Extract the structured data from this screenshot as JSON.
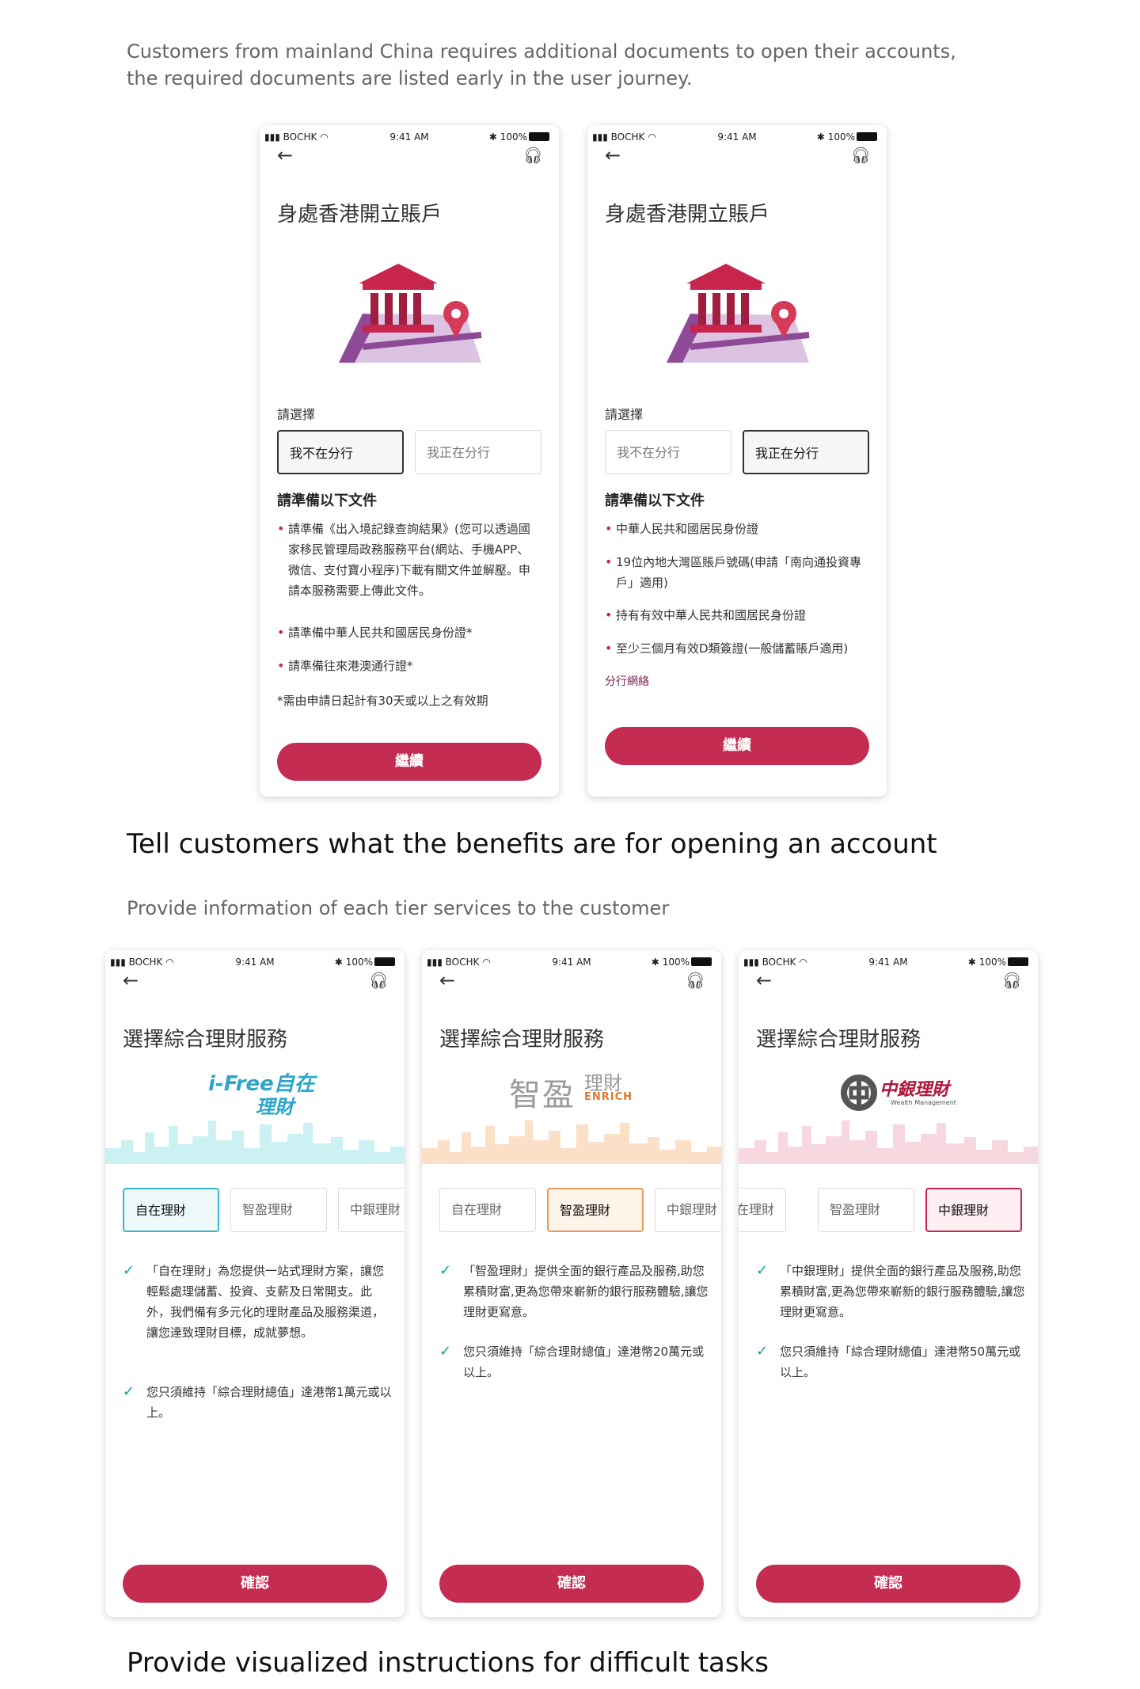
{
  "intro": {
    "text": "Customers from mainland China requires additional documents to open their accounts, the required documents are listed early in the user journey."
  },
  "status_bar": {
    "carrier": "BOCHK",
    "time": "9:41 AM",
    "battery": "100%"
  },
  "open_account": {
    "title": "身處香港開立賬戶",
    "choose_label": "請選擇",
    "option_not_branch": "我不在分行",
    "option_in_branch": "我正在分行",
    "docs_heading": "請準備以下文件",
    "screen1_docs": [
      "請準備《出入境記錄查詢結果》(您可以透過國家移民管理局政務服務平台(網站、手機APP、微信、支付寶小程序)下載有關文件並解壓。申請本服務需要上傳此文件。",
      "請準備中華人民共和國居民身份證*",
      "請準備往來港澳通行證*"
    ],
    "screen1_note": "*需由申請日起計有30天或以上之有效期",
    "screen2_docs": [
      "中華人民共和國居民身份證",
      "19位內地大灣區賬戶號碼(申請「南向通投資專戶」適用)",
      "持有有效中華人民共和國居民身份證",
      "至少三個月有效D類簽證(一般儲蓄賬戶適用)"
    ],
    "branch_link": "分行網絡",
    "continue": "繼續"
  },
  "section_benefits": {
    "heading": "Tell customers what the benefits are for opening an account",
    "desc": "Provide information of each tier services to the customer"
  },
  "tiers": {
    "title": "選擇綜合理財服務",
    "tab_ifree": "自在理財",
    "tab_enrich": "智盈理財",
    "tab_wealth": "中銀理財",
    "tab_wealth_partial": "中銀理財",
    "tab_ifree_partial": "在理財",
    "logo_ifree_line1": "i-Free自在",
    "logo_ifree_line2": "理財",
    "logo_enrich_cn": "智盈",
    "logo_enrich_sub": "理財",
    "logo_enrich_en": "ENRICH",
    "logo_wealth_cn": "中銀理財",
    "logo_wealth_en": "Wealth Management",
    "ifree_points": [
      "「自在理財」為您提供一站式理財方案，讓您輕鬆處理儲蓄、投資、支薪及日常開支。此外，我們備有多元化的理財產品及服務渠道，讓您達致理財目標，成就夢想。",
      "您只須維持「綜合理財總值」達港幣1萬元或以上。"
    ],
    "enrich_points": [
      "「智盈理財」提供全面的銀行產品及服務,助您累積財富,更為您帶來嶄新的銀行服務體驗,讓您理財更寫意。",
      "您只須維持「綜合理財總值」達港幣20萬元或以上。"
    ],
    "wealth_points": [
      "「中銀理財」提供全面的銀行產品及服務,助您累積財富,更為您帶來嶄新的銀行服務體驗,讓您理財更寫意。",
      "您只須維持「綜合理財總值」達港幣50萬元或以上。"
    ],
    "confirm": "確認",
    "colors": {
      "ifree": "#35b7c8",
      "enrich": "#e89a5a",
      "wealth": "#c8254c"
    }
  },
  "section_visual": {
    "heading": "Provide visualized instructions for difficult tasks"
  },
  "icons": [
    "back-arrow-icon",
    "headset-icon",
    "signal-icon",
    "wifi-icon",
    "bluetooth-icon",
    "battery-icon",
    "bank-map-icon",
    "checkmark-icon"
  ]
}
